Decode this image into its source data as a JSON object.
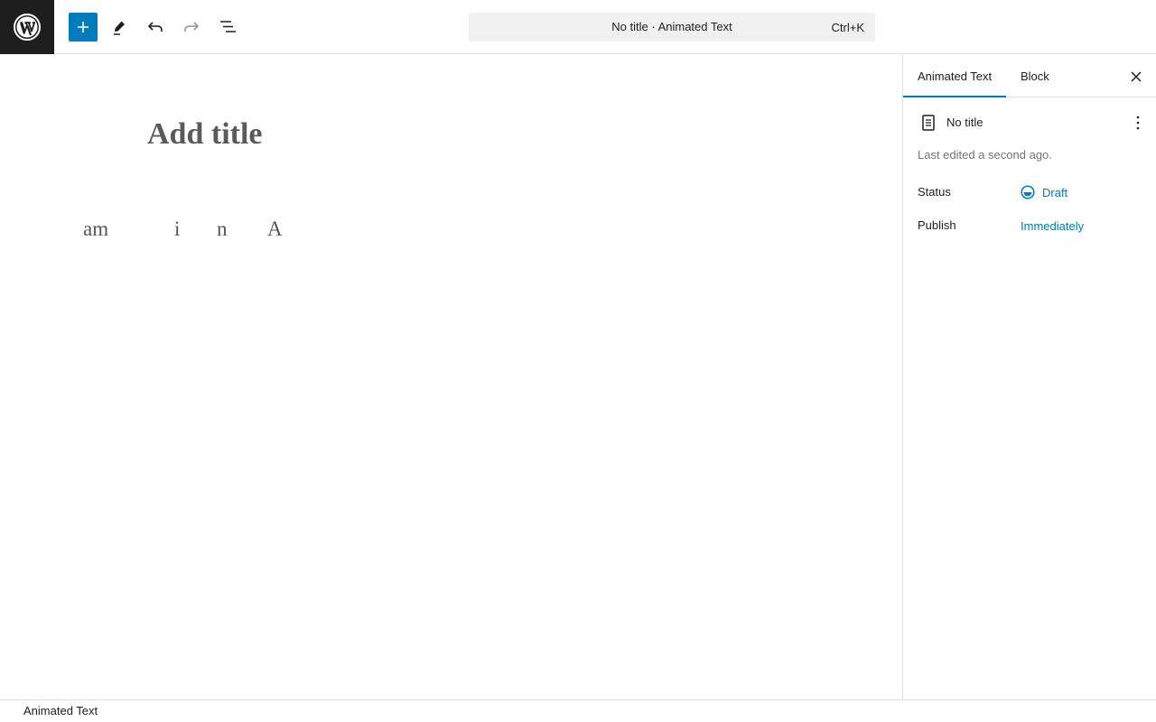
{
  "toolbar": {
    "logo_icon": "wordpress-logo-icon",
    "add_icon": "plus-icon",
    "edit_icon": "pencil-icon",
    "undo_icon": "undo-icon",
    "redo_icon": "redo-icon",
    "list_icon": "document-overview-icon",
    "accent_color": "#007cba"
  },
  "command_bar": {
    "title": "No title · Animated Text",
    "shortcut": "Ctrl+K"
  },
  "editor": {
    "title_placeholder": "Add title",
    "animated_letters": [
      "am",
      "i",
      "n",
      "A"
    ]
  },
  "sidebar": {
    "tabs": [
      {
        "label": "Animated Text",
        "active": true
      },
      {
        "label": "Block",
        "active": false
      }
    ],
    "close_icon": "close-icon",
    "document": {
      "icon": "page-icon",
      "title": "No title",
      "more_icon": "more-vertical-icon"
    },
    "last_edited": "Last edited a second ago.",
    "meta": {
      "status_label": "Status",
      "status_value": "Draft",
      "status_icon": "draft-status-icon",
      "publish_label": "Publish",
      "publish_value": "Immediately"
    }
  },
  "footer": {
    "breadcrumb": "Animated Text"
  }
}
